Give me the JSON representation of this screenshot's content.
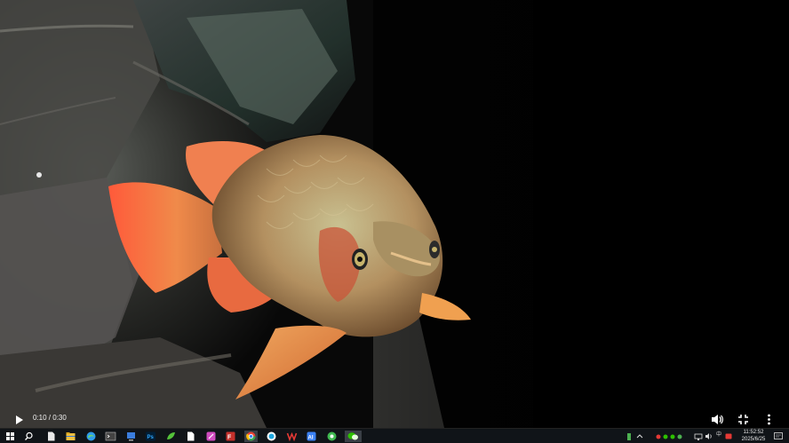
{
  "player": {
    "time_display": "0:10 / 0:30"
  },
  "taskbar": {
    "apps": [
      {
        "name": "start-icon",
        "color": "#ffffff"
      },
      {
        "name": "search-icon",
        "color": "#ffffff"
      },
      {
        "name": "file-icon",
        "color": "#e8e8e8"
      },
      {
        "name": "file-explorer-icon",
        "color": "#f0c040"
      },
      {
        "name": "edge-icon",
        "color": "#2e9bea"
      },
      {
        "name": "terminal-icon",
        "color": "#444444"
      },
      {
        "name": "pc-manager-icon",
        "color": "#3b7ddd"
      },
      {
        "name": "photoshop-icon",
        "color": "#31a8ff"
      },
      {
        "name": "app-green-icon",
        "color": "#54c23a"
      },
      {
        "name": "document-icon",
        "color": "#ffffff"
      },
      {
        "name": "pen-app-icon",
        "color": "#d04cc0"
      },
      {
        "name": "filezilla-icon",
        "color": "#c4302b"
      },
      {
        "name": "chrome-icon",
        "color": "#fbbc05"
      },
      {
        "name": "capture-app-icon",
        "color": "#1ea7e0"
      },
      {
        "name": "wps-icon",
        "color": "#e53935"
      },
      {
        "name": "ai-app-icon",
        "color": "#3b82f6"
      },
      {
        "name": "green-circle-app-icon",
        "color": "#3fb950"
      },
      {
        "name": "wechat-icon",
        "color": "#2dc100"
      }
    ],
    "tray": {
      "ime_label": "中",
      "clock_time": "11:52:52",
      "clock_date": "2025/6/25"
    }
  }
}
